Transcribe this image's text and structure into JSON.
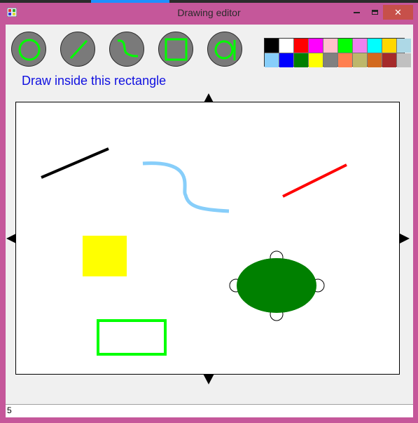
{
  "window": {
    "title": "Drawing editor",
    "close_glyph": "✕"
  },
  "tools": [
    {
      "name": "ellipse-tool",
      "icon": "circle-icon"
    },
    {
      "name": "line-tool",
      "icon": "line-icon"
    },
    {
      "name": "curve-tool",
      "icon": "curve-icon"
    },
    {
      "name": "rectangle-tool",
      "icon": "square-icon"
    },
    {
      "name": "select-tool",
      "icon": "select-icon"
    }
  ],
  "palette": [
    "#000000",
    "#ffffff",
    "#ff0000",
    "#ff00ff",
    "#ffc0cb",
    "#00ff00",
    "#ee82ee",
    "#00ffff",
    "#ffd700",
    "#add8e6",
    "#87cefa",
    "#0000ff",
    "#008000",
    "#ffff00",
    "#808080",
    "#ff7f50",
    "#bdb76b",
    "#d2691e",
    "#a52a2a",
    "#c0c0c0"
  ],
  "hint_text": "Draw inside this rectangle",
  "status_value": "5",
  "shapes": [
    {
      "type": "line",
      "color": "#000000"
    },
    {
      "type": "curve",
      "color": "#87cefa"
    },
    {
      "type": "line",
      "color": "#ff0000"
    },
    {
      "type": "filled-rectangle",
      "color": "#ffff00"
    },
    {
      "type": "filled-ellipse",
      "color": "#008000",
      "selected": true
    },
    {
      "type": "outlined-rectangle",
      "color": "#00ff00"
    }
  ]
}
